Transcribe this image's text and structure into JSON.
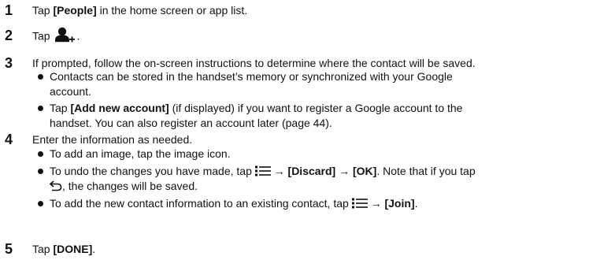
{
  "steps": [
    {
      "number": "1",
      "pre": "Tap ",
      "bold": "[People]",
      "post": " in the home screen or app list."
    },
    {
      "number": "2",
      "pre": "Tap ",
      "icon": "add-contact-icon",
      "post": "."
    },
    {
      "number": "3",
      "text": "If prompted, follow the on-screen instructions to determine where the contact will be saved.",
      "bullets": [
        {
          "line1": "Contacts can be stored in the handset’s memory or synchronized with your Google",
          "line2": "account."
        },
        {
          "pre": "Tap ",
          "bold": "[Add new account]",
          "post": " (if displayed) if you want to register a Google account to the",
          "line2": "handset. You can also register an account later (page 44)."
        }
      ]
    },
    {
      "number": "4",
      "text": "Enter the information as needed.",
      "bullets": [
        {
          "text": "To add an image, tap the image icon."
        },
        {
          "pre": "To undo the changes you have made, tap ",
          "icon": "menu-icon",
          "arrow1": " → ",
          "bold1": "[Discard]",
          "arrow2": " → ",
          "bold2": "[OK]",
          "post": ". Note that if you tap",
          "line2_icon": "back-icon",
          "line2": ", the changes will be saved."
        },
        {
          "pre": "To add the new contact information to an existing contact, tap ",
          "icon": "menu-icon",
          "arrow": " → ",
          "bold": "[Join]",
          "post": "."
        }
      ]
    },
    {
      "number": "5",
      "pre": "Tap ",
      "bold": "[DONE]",
      "post": "."
    }
  ]
}
